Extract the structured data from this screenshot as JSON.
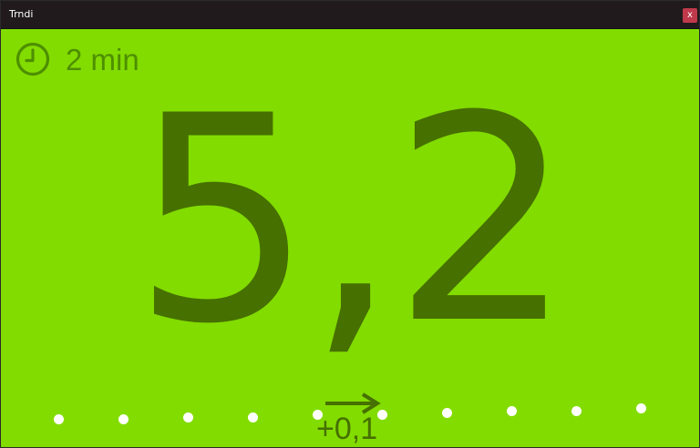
{
  "window": {
    "title": "Trndi",
    "close_label": "x"
  },
  "main": {
    "time_ago": "2 min",
    "reading": "5,2",
    "delta": "+0,1",
    "trend": "flat",
    "clock_icon": "clock-icon",
    "arrow_icon": "arrow-right-icon"
  },
  "history": {
    "point_count": 10
  },
  "colors": {
    "background": "#82dc00",
    "foreground": "#467000",
    "titlebar": "#201a1c",
    "close_button": "#c0394b",
    "dots": "#ffffff"
  }
}
